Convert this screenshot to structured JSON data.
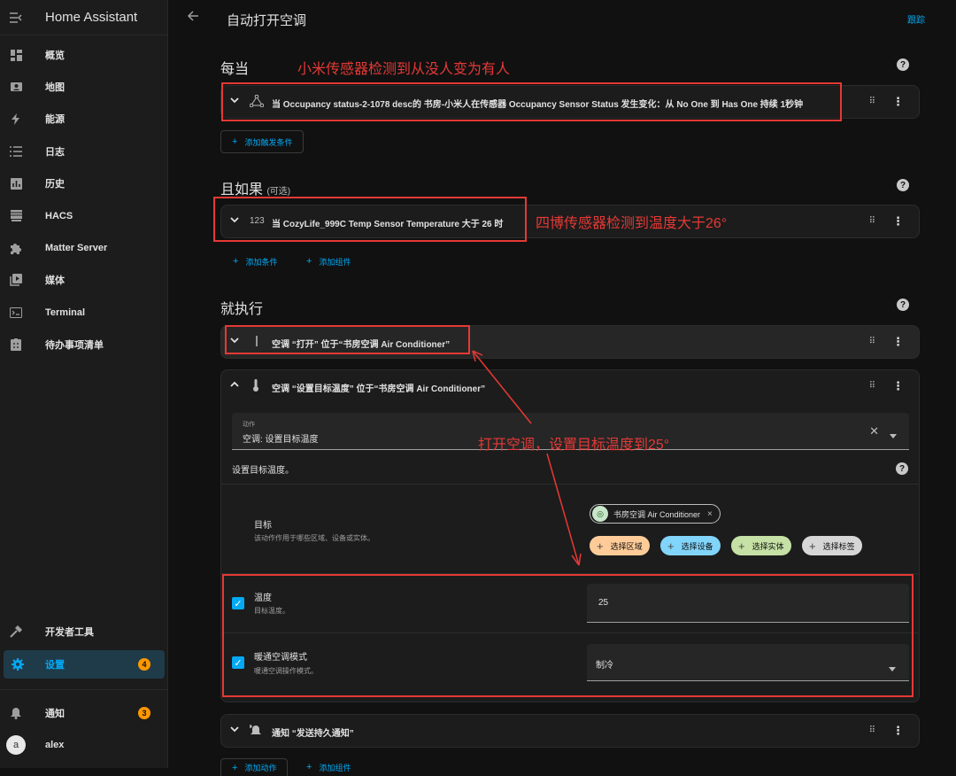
{
  "app": {
    "title": "Home Assistant"
  },
  "sidebar": {
    "items": [
      {
        "label": "概览",
        "icon": "dashboard-icon"
      },
      {
        "label": "地图",
        "icon": "map-icon"
      },
      {
        "label": "能源",
        "icon": "energy-icon"
      },
      {
        "label": "日志",
        "icon": "logbook-icon"
      },
      {
        "label": "历史",
        "icon": "history-icon"
      },
      {
        "label": "HACS",
        "icon": "hacs-icon"
      },
      {
        "label": "Matter Server",
        "icon": "puzzle-icon"
      },
      {
        "label": "媒体",
        "icon": "media-icon"
      },
      {
        "label": "Terminal",
        "icon": "terminal-icon"
      },
      {
        "label": "待办事项清单",
        "icon": "todo-icon"
      }
    ],
    "dev_tools": "开发者工具",
    "settings": {
      "label": "设置",
      "badge": "4"
    },
    "notifications": {
      "label": "通知",
      "badge": "3"
    },
    "user": {
      "name": "alex",
      "initial": "a"
    }
  },
  "header": {
    "title": "自动打开空调",
    "follow": "跟踪"
  },
  "when": {
    "title": "每当",
    "trigger_text": "当 Occupancy status-2-1078 desc的 书房-小米人在传感器 Occupancy Sensor Status 发生变化：从 No One 到 Has One 持续 1秒钟",
    "add_trigger": "添加触发条件"
  },
  "and_if": {
    "title": "且如果",
    "optional": "(可选)",
    "condition_icon": "123",
    "condition_text": "当 CozyLife_999C Temp Sensor Temperature 大于 26 时",
    "add_condition": "添加条件",
    "add_building_block": "添加组件"
  },
  "then_do": {
    "title": "就执行",
    "action1": "空调 “打开” 位于“书房空调 Air Conditioner”",
    "action2": "空调 “设置目标温度” 位于“书房空调 Air Conditioner”",
    "action_field_label": "动作",
    "action_field_value": "空调: 设置目标温度",
    "description": "设置目标温度。",
    "target_label": "目标",
    "target_sub": "该动作作用于哪些区域、设备或实体。",
    "target_chip": "书房空调 Air Conditioner",
    "chips": [
      "选择区域",
      "选择设备",
      "选择实体",
      "选择标签"
    ],
    "temperature_label": "温度",
    "temperature_sub": "目标温度。",
    "temperature_value": "25",
    "hvac_label": "暖通空调模式",
    "hvac_sub": "暖通空调操作模式。",
    "hvac_value": "制冷",
    "action3": "通知 “发送持久通知”",
    "add_action": "添加动作",
    "add_block": "添加组件"
  },
  "annotations": {
    "a1": "小米传感器检测到从没人变为有人",
    "a2": "四博传感器检测到温度大于26°",
    "a3": "打开空调，设置目标温度到25°"
  },
  "colors": {
    "accent": "#03a9f4",
    "annotation": "#e53935",
    "badge": "#ff9800"
  }
}
